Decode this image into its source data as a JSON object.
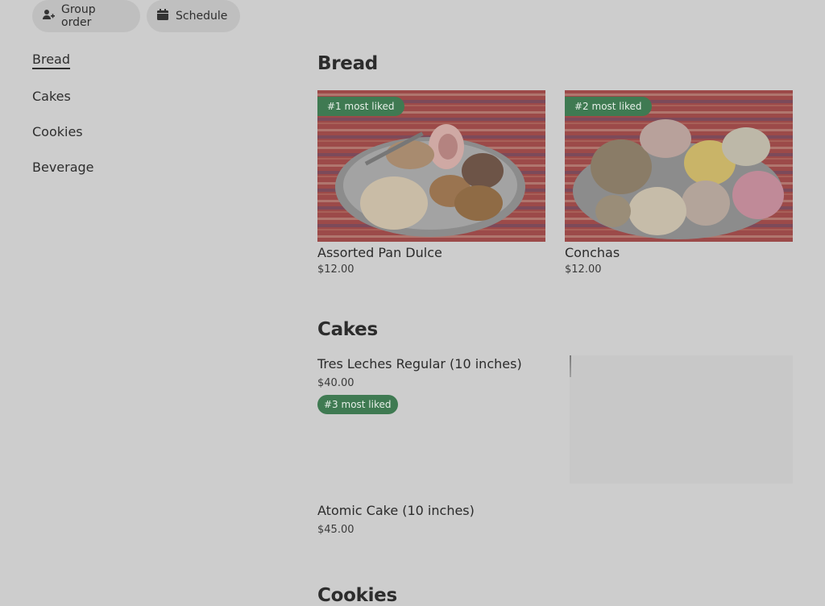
{
  "toolbar": {
    "group_order_label": "Group order",
    "schedule_label": "Schedule"
  },
  "sidebar": {
    "items": [
      {
        "label": "Bread",
        "active": true
      },
      {
        "label": "Cakes"
      },
      {
        "label": "Cookies"
      },
      {
        "label": "Beverage"
      }
    ]
  },
  "sections": {
    "bread": {
      "title": "Bread",
      "items": [
        {
          "name": "Assorted Pan Dulce",
          "price": "$12.00",
          "badge": "#1 most liked"
        },
        {
          "name": "Conchas",
          "price": "$12.00",
          "badge": "#2 most liked"
        }
      ]
    },
    "cakes": {
      "title": "Cakes",
      "items": [
        {
          "name": "Tres Leches Regular (10 inches)",
          "price": "$40.00",
          "badge": "#3 most liked"
        },
        {
          "name": "Atomic Cake (10 inches)",
          "price": "$45.00"
        }
      ]
    },
    "cookies": {
      "title": "Cookies"
    }
  },
  "colors": {
    "overlay_bg": "#cdcdcd",
    "badge_green": "#3f7a52"
  }
}
